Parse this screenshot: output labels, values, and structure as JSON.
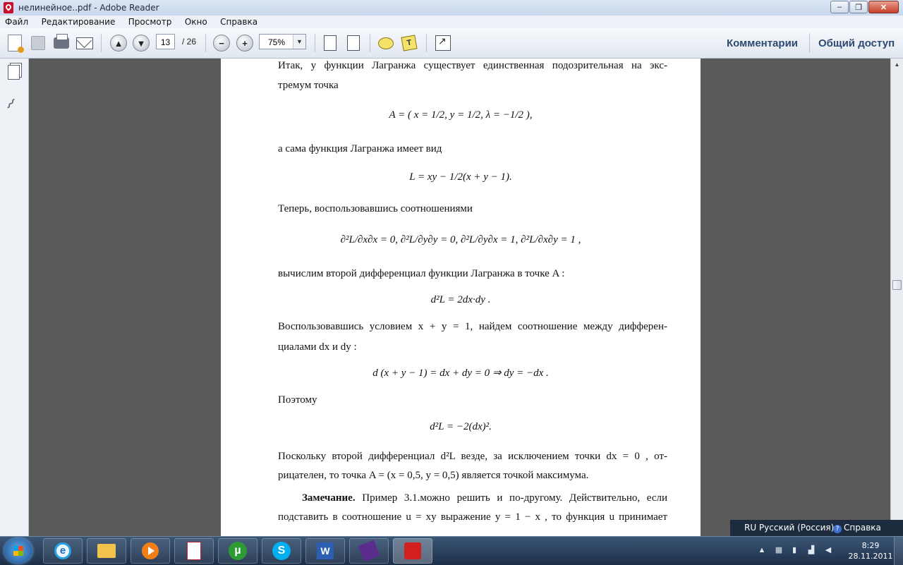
{
  "window": {
    "title": "нелинейное..pdf - Adobe Reader",
    "controls": {
      "minimize": "–",
      "maximize": "❐",
      "close": "✕"
    }
  },
  "menu": [
    "Файл",
    "Редактирование",
    "Просмотр",
    "Окно",
    "Справка"
  ],
  "toolbar": {
    "page_current": "13",
    "page_total": "/ 26",
    "zoom": "75%",
    "zoom_arrow": "▼",
    "up": "▲",
    "down": "▼",
    "zoom_out": "−",
    "zoom_in": "+",
    "comments": "Комментарии",
    "share": "Общий доступ"
  },
  "page": {
    "l1": "Итак, у функции Лагранжа существует единственная подозрительная на экс-",
    "l2": "тремум точка",
    "eq1": "A = ( x = 1/2, y = 1/2, λ = −1/2 ),",
    "l3": "а сама функция Лагранжа имеет вид",
    "eq2": "L = xy − 1/2(x + y − 1).",
    "l4": "Теперь, воспользовавшись соотношениями",
    "eq3": "∂²L/∂x∂x = 0,  ∂²L/∂y∂y = 0,  ∂²L/∂y∂x = 1,  ∂²L/∂x∂y = 1 ,",
    "l5": "вычислим второй дифференциал функции Лагранжа в точке  A :",
    "eq4": "d²L = 2dx·dy .",
    "l6": "Воспользовавшись условием  x + y = 1,  найдем соотношение между дифферен-",
    "l7": "циалами  dx  и  dy :",
    "eq5": "d (x + y − 1) = dx + dy = 0 ⇒ dy = −dx .",
    "l8": "Поэтому",
    "eq6": "d²L = −2(dx)².",
    "l9": "Поскольку второй дифференциал  d²L  везде, за исключением точки  dx = 0 , от-",
    "l10": "рицателен, то точка  A = (x = 0,5, y = 0,5)  является точкой максимума.",
    "note_bold": "Замечание.",
    "note_rest": " Пример 3.1.можно решить и по-другому. Действительно, если",
    "l11": "подставить в соотношение  u = xy  выражение  y = 1 − x , то функция  u  принимает"
  },
  "langbar": {
    "lang": "RU Русский (Россия)",
    "help": "Справка",
    "help_icon": "?"
  },
  "taskbar": {
    "time": "8:29",
    "date": "28.11.2011",
    "ie_letter": "e",
    "ut_letter": "µ",
    "skype_letter": "S",
    "word_letter": "W"
  }
}
